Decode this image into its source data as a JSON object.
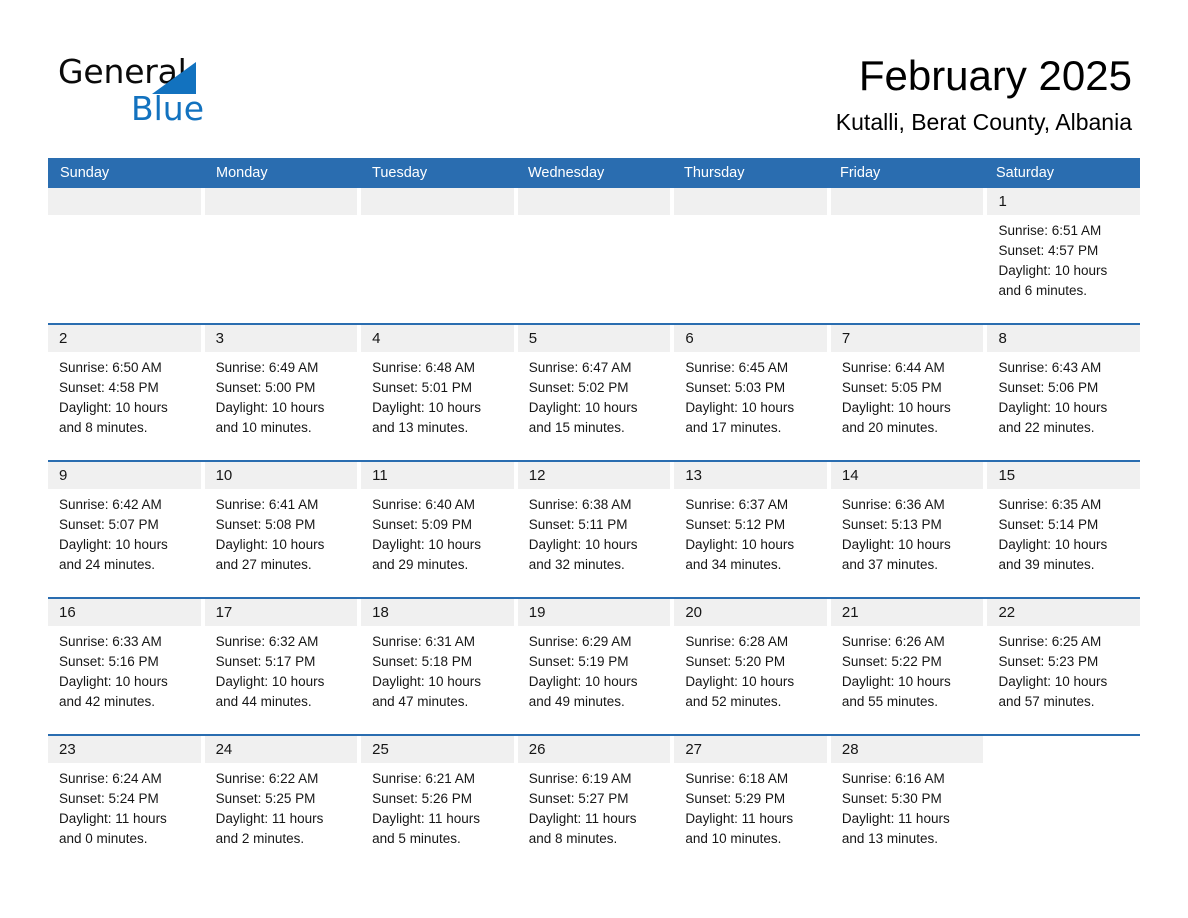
{
  "brand": {
    "word_one": "General",
    "word_two": "Blue",
    "triangle_color": "#1272bf"
  },
  "header": {
    "month_title": "February 2025",
    "location": "Kutalli, Berat County, Albania",
    "header_bg": "#2a6db0",
    "day_band_bg": "#f0f0f0"
  },
  "weekdays": [
    "Sunday",
    "Monday",
    "Tuesday",
    "Wednesday",
    "Thursday",
    "Friday",
    "Saturday"
  ],
  "weeks": [
    [
      {
        "date": "",
        "empty": true,
        "sunrise": "",
        "sunset": "",
        "daylight_line1": "",
        "daylight_line2": ""
      },
      {
        "date": "",
        "empty": true,
        "sunrise": "",
        "sunset": "",
        "daylight_line1": "",
        "daylight_line2": ""
      },
      {
        "date": "",
        "empty": true,
        "sunrise": "",
        "sunset": "",
        "daylight_line1": "",
        "daylight_line2": ""
      },
      {
        "date": "",
        "empty": true,
        "sunrise": "",
        "sunset": "",
        "daylight_line1": "",
        "daylight_line2": ""
      },
      {
        "date": "",
        "empty": true,
        "sunrise": "",
        "sunset": "",
        "daylight_line1": "",
        "daylight_line2": ""
      },
      {
        "date": "",
        "empty": true,
        "sunrise": "",
        "sunset": "",
        "daylight_line1": "",
        "daylight_line2": ""
      },
      {
        "date": "1",
        "empty": false,
        "sunrise": "Sunrise: 6:51 AM",
        "sunset": "Sunset: 4:57 PM",
        "daylight_line1": "Daylight: 10 hours",
        "daylight_line2": "and 6 minutes."
      }
    ],
    [
      {
        "date": "2",
        "empty": false,
        "sunrise": "Sunrise: 6:50 AM",
        "sunset": "Sunset: 4:58 PM",
        "daylight_line1": "Daylight: 10 hours",
        "daylight_line2": "and 8 minutes."
      },
      {
        "date": "3",
        "empty": false,
        "sunrise": "Sunrise: 6:49 AM",
        "sunset": "Sunset: 5:00 PM",
        "daylight_line1": "Daylight: 10 hours",
        "daylight_line2": "and 10 minutes."
      },
      {
        "date": "4",
        "empty": false,
        "sunrise": "Sunrise: 6:48 AM",
        "sunset": "Sunset: 5:01 PM",
        "daylight_line1": "Daylight: 10 hours",
        "daylight_line2": "and 13 minutes."
      },
      {
        "date": "5",
        "empty": false,
        "sunrise": "Sunrise: 6:47 AM",
        "sunset": "Sunset: 5:02 PM",
        "daylight_line1": "Daylight: 10 hours",
        "daylight_line2": "and 15 minutes."
      },
      {
        "date": "6",
        "empty": false,
        "sunrise": "Sunrise: 6:45 AM",
        "sunset": "Sunset: 5:03 PM",
        "daylight_line1": "Daylight: 10 hours",
        "daylight_line2": "and 17 minutes."
      },
      {
        "date": "7",
        "empty": false,
        "sunrise": "Sunrise: 6:44 AM",
        "sunset": "Sunset: 5:05 PM",
        "daylight_line1": "Daylight: 10 hours",
        "daylight_line2": "and 20 minutes."
      },
      {
        "date": "8",
        "empty": false,
        "sunrise": "Sunrise: 6:43 AM",
        "sunset": "Sunset: 5:06 PM",
        "daylight_line1": "Daylight: 10 hours",
        "daylight_line2": "and 22 minutes."
      }
    ],
    [
      {
        "date": "9",
        "empty": false,
        "sunrise": "Sunrise: 6:42 AM",
        "sunset": "Sunset: 5:07 PM",
        "daylight_line1": "Daylight: 10 hours",
        "daylight_line2": "and 24 minutes."
      },
      {
        "date": "10",
        "empty": false,
        "sunrise": "Sunrise: 6:41 AM",
        "sunset": "Sunset: 5:08 PM",
        "daylight_line1": "Daylight: 10 hours",
        "daylight_line2": "and 27 minutes."
      },
      {
        "date": "11",
        "empty": false,
        "sunrise": "Sunrise: 6:40 AM",
        "sunset": "Sunset: 5:09 PM",
        "daylight_line1": "Daylight: 10 hours",
        "daylight_line2": "and 29 minutes."
      },
      {
        "date": "12",
        "empty": false,
        "sunrise": "Sunrise: 6:38 AM",
        "sunset": "Sunset: 5:11 PM",
        "daylight_line1": "Daylight: 10 hours",
        "daylight_line2": "and 32 minutes."
      },
      {
        "date": "13",
        "empty": false,
        "sunrise": "Sunrise: 6:37 AM",
        "sunset": "Sunset: 5:12 PM",
        "daylight_line1": "Daylight: 10 hours",
        "daylight_line2": "and 34 minutes."
      },
      {
        "date": "14",
        "empty": false,
        "sunrise": "Sunrise: 6:36 AM",
        "sunset": "Sunset: 5:13 PM",
        "daylight_line1": "Daylight: 10 hours",
        "daylight_line2": "and 37 minutes."
      },
      {
        "date": "15",
        "empty": false,
        "sunrise": "Sunrise: 6:35 AM",
        "sunset": "Sunset: 5:14 PM",
        "daylight_line1": "Daylight: 10 hours",
        "daylight_line2": "and 39 minutes."
      }
    ],
    [
      {
        "date": "16",
        "empty": false,
        "sunrise": "Sunrise: 6:33 AM",
        "sunset": "Sunset: 5:16 PM",
        "daylight_line1": "Daylight: 10 hours",
        "daylight_line2": "and 42 minutes."
      },
      {
        "date": "17",
        "empty": false,
        "sunrise": "Sunrise: 6:32 AM",
        "sunset": "Sunset: 5:17 PM",
        "daylight_line1": "Daylight: 10 hours",
        "daylight_line2": "and 44 minutes."
      },
      {
        "date": "18",
        "empty": false,
        "sunrise": "Sunrise: 6:31 AM",
        "sunset": "Sunset: 5:18 PM",
        "daylight_line1": "Daylight: 10 hours",
        "daylight_line2": "and 47 minutes."
      },
      {
        "date": "19",
        "empty": false,
        "sunrise": "Sunrise: 6:29 AM",
        "sunset": "Sunset: 5:19 PM",
        "daylight_line1": "Daylight: 10 hours",
        "daylight_line2": "and 49 minutes."
      },
      {
        "date": "20",
        "empty": false,
        "sunrise": "Sunrise: 6:28 AM",
        "sunset": "Sunset: 5:20 PM",
        "daylight_line1": "Daylight: 10 hours",
        "daylight_line2": "and 52 minutes."
      },
      {
        "date": "21",
        "empty": false,
        "sunrise": "Sunrise: 6:26 AM",
        "sunset": "Sunset: 5:22 PM",
        "daylight_line1": "Daylight: 10 hours",
        "daylight_line2": "and 55 minutes."
      },
      {
        "date": "22",
        "empty": false,
        "sunrise": "Sunrise: 6:25 AM",
        "sunset": "Sunset: 5:23 PM",
        "daylight_line1": "Daylight: 10 hours",
        "daylight_line2": "and 57 minutes."
      }
    ],
    [
      {
        "date": "23",
        "empty": false,
        "sunrise": "Sunrise: 6:24 AM",
        "sunset": "Sunset: 5:24 PM",
        "daylight_line1": "Daylight: 11 hours",
        "daylight_line2": "and 0 minutes."
      },
      {
        "date": "24",
        "empty": false,
        "sunrise": "Sunrise: 6:22 AM",
        "sunset": "Sunset: 5:25 PM",
        "daylight_line1": "Daylight: 11 hours",
        "daylight_line2": "and 2 minutes."
      },
      {
        "date": "25",
        "empty": false,
        "sunrise": "Sunrise: 6:21 AM",
        "sunset": "Sunset: 5:26 PM",
        "daylight_line1": "Daylight: 11 hours",
        "daylight_line2": "and 5 minutes."
      },
      {
        "date": "26",
        "empty": false,
        "sunrise": "Sunrise: 6:19 AM",
        "sunset": "Sunset: 5:27 PM",
        "daylight_line1": "Daylight: 11 hours",
        "daylight_line2": "and 8 minutes."
      },
      {
        "date": "27",
        "empty": false,
        "sunrise": "Sunrise: 6:18 AM",
        "sunset": "Sunset: 5:29 PM",
        "daylight_line1": "Daylight: 11 hours",
        "daylight_line2": "and 10 minutes."
      },
      {
        "date": "28",
        "empty": false,
        "sunrise": "Sunrise: 6:16 AM",
        "sunset": "Sunset: 5:30 PM",
        "daylight_line1": "Daylight: 11 hours",
        "daylight_line2": "and 13 minutes."
      },
      {
        "date": "",
        "empty": true,
        "blank": true,
        "sunrise": "",
        "sunset": "",
        "daylight_line1": "",
        "daylight_line2": ""
      }
    ]
  ]
}
